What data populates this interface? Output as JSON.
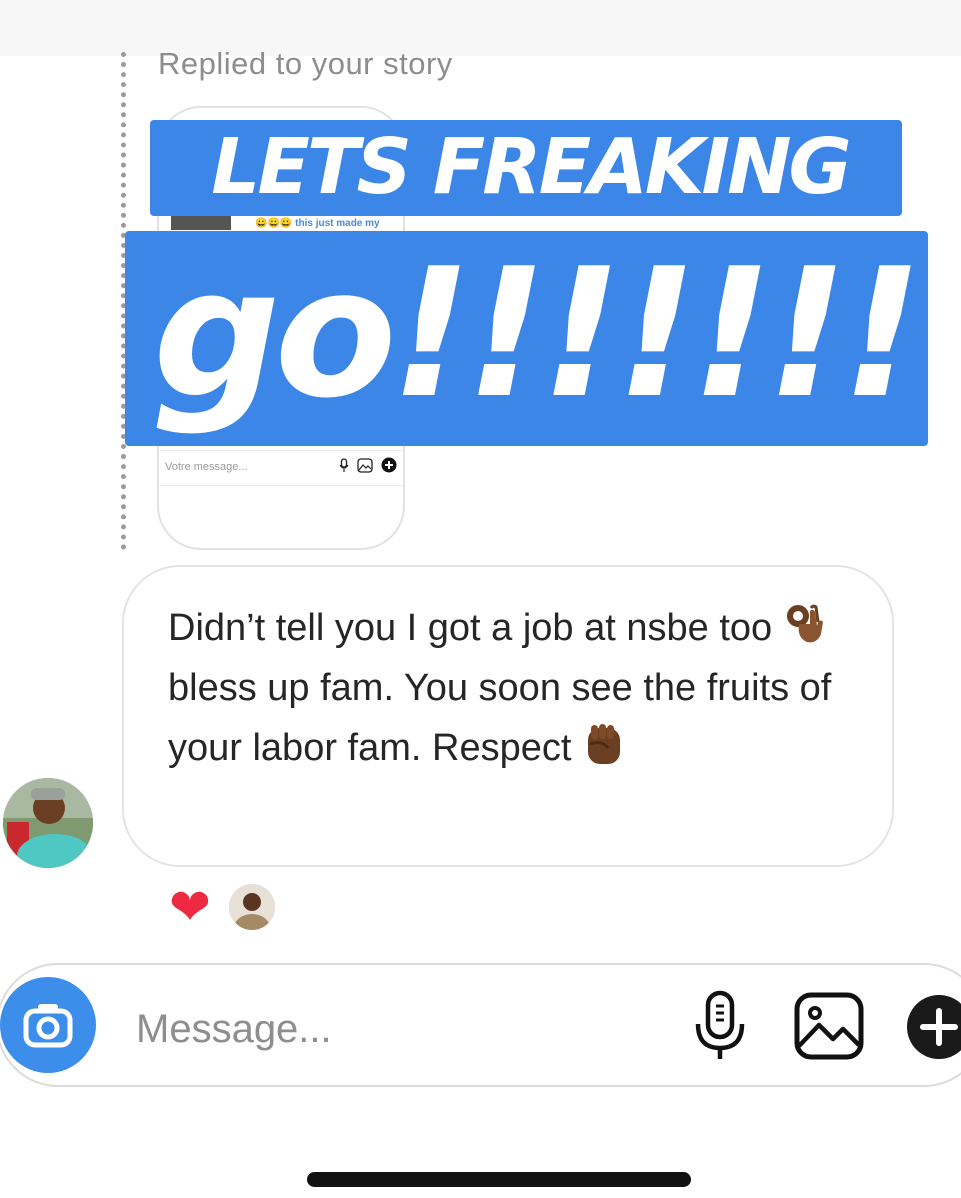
{
  "thread": {
    "reply_context": "Replied to your story",
    "story_preview": {
      "caption": "😀😀😀 this just made my",
      "input_placeholder": "Votre message..."
    },
    "overlay_line1": "LETS FREAKING",
    "overlay_line2": "go!!!!!!!",
    "message": {
      "segments": [
        "Didn’t tell you I got a job at nsbe too",
        "bless up fam. You soon see the fruits of your labor fam. Respect"
      ],
      "emojis": [
        "ok-hand",
        "raised-fist"
      ]
    },
    "reactions": {
      "emoji": "❤"
    }
  },
  "composer": {
    "placeholder": "Message..."
  },
  "colors": {
    "accent": "#3b86e6",
    "heart": "#ee2a43",
    "camera": "#3d8eea"
  },
  "icons": [
    "camera-icon",
    "microphone-icon",
    "gallery-icon",
    "plus-icon",
    "ok-hand-emoji",
    "raised-fist-emoji",
    "heart-icon"
  ]
}
